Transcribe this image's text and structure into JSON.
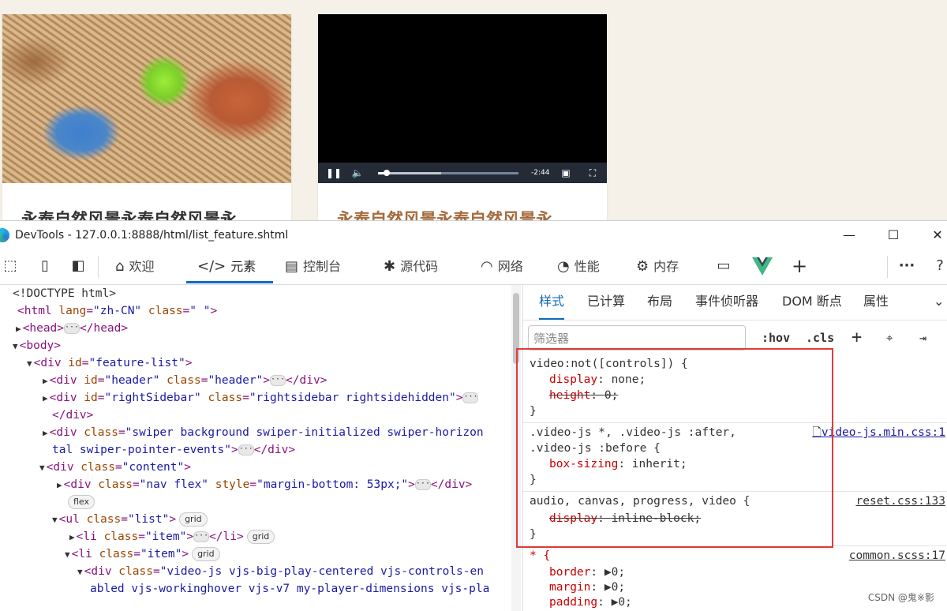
{
  "page": {
    "card1": {
      "title": "永泰自然风景永泰自然风景永"
    },
    "card2": {
      "title": "永泰自然风景永泰自然风景永",
      "video": {
        "time": "-2:44",
        "progress": 0.06,
        "buffered": 0.45
      }
    }
  },
  "devtools": {
    "window_title": "DevTools - 127.0.0.1:8888/html/list_feature.shtml",
    "window_buttons": {
      "minimize": "—",
      "maximize": "☐",
      "close": "✕"
    },
    "tabs": [
      {
        "label": "欢迎",
        "icon": "home-icon"
      },
      {
        "label": "元素",
        "icon": "code-icon",
        "active": true
      },
      {
        "label": "控制台",
        "icon": "console-icon"
      },
      {
        "label": "源代码",
        "icon": "bug-icon"
      },
      {
        "label": "网络",
        "icon": "wifi-icon"
      },
      {
        "label": "性能",
        "icon": "gauge-icon"
      },
      {
        "label": "内存",
        "icon": "chip-icon"
      }
    ],
    "elements": {
      "l1": "<!DOCTYPE html>",
      "l2_tag": "<html",
      "l2_attr": "lang",
      "l2_val": "\"zh-CN\"",
      "l2_attr2": "class",
      "l2_val2": "\" \"",
      "l2_end": ">",
      "l3a": "<head>",
      "l3b": "</head>",
      "l4": "<body>",
      "l5_tag": "<div",
      "l5_attr": "id",
      "l5_val": "\"feature-list\"",
      "l5_end": ">",
      "l6_tag": "<div",
      "l6_attr": "id",
      "l6_val": "\"header\"",
      "l6_attr2": "class",
      "l6_val2": "\"header\"",
      "l6_end": ">",
      "l6_close": "</div>",
      "l7_tag": "<div",
      "l7_attr": "id",
      "l7_val": "\"rightSidebar\"",
      "l7_attr2": "class",
      "l7_val2": "\"rightsidebar rightsidehidden\"",
      "l7_end": ">",
      "l8": "</div>",
      "l9_tag": "<div",
      "l9_attr": "class",
      "l9_val": "\"swiper background swiper-initialized swiper-horizon",
      "l10_val": "tal swiper-pointer-events\"",
      "l10_end": ">",
      "l10_close": "</div>",
      "l11_tag": "<div",
      "l11_attr": "class",
      "l11_val": "\"content\"",
      "l11_end": ">",
      "l12_tag": "<div",
      "l12_attr": "class",
      "l12_val": "\"nav flex\"",
      "l12_attr2": "style",
      "l12_val2": "\"margin-bottom: 53px;\"",
      "l12_end": ">",
      "l12_close": "</div>",
      "badge_flex": "flex",
      "l14_tag": "<ul",
      "l14_attr": "class",
      "l14_val": "\"list\"",
      "l14_end": ">",
      "badge_grid": "grid",
      "l15_tag": "<li",
      "l15_attr": "class",
      "l15_val": "\"item\"",
      "l15_end": ">",
      "l15_close": "</li>",
      "l16_tag": "<li",
      "l16_attr": "class",
      "l16_val": "\"item\"",
      "l16_end": ">",
      "l17_tag": "<div",
      "l17_attr": "class",
      "l17_val": "\"video-js vjs-big-play-centered vjs-controls-en",
      "l18_val": "abled vjs-workinghover vjs-v7 my-player-dimensions vjs-pla"
    },
    "styles": {
      "tabs": [
        "样式",
        "已计算",
        "布局",
        "事件侦听器",
        "DOM 断点",
        "属性"
      ],
      "filter_placeholder": "筛选器",
      "hov": ":hov",
      "cls": ".cls",
      "rules": {
        "r1_sel": "video:not([controls]) {",
        "r1_p1_name": "display",
        "r1_p1_val": "none;",
        "r1_p2_name": "height",
        "r1_p2_val": "0;",
        "r2_sel1": ".video-js *, .video-js :after,",
        "r2_sel2": ".video-js :before {",
        "r2_src": "video-js.min.css:1",
        "r2_p1_name": "box-sizing",
        "r2_p1_val": "inherit;",
        "r3_sel": "audio, canvas, progress, video {",
        "r3_src": "reset.css:133",
        "r3_p1_name": "display",
        "r3_p1_val": "inline-block;",
        "r4_sel": "* {",
        "r4_src": "common.scss:17",
        "r4_p1_name": "border",
        "r4_p1_val": "0;",
        "r4_p2_name": "margin",
        "r4_p2_val": "0;",
        "r4_p3_name": "padding",
        "r4_p3_val": "0;",
        "close": "}"
      }
    },
    "watermark": "CSDN @鬼※影"
  }
}
